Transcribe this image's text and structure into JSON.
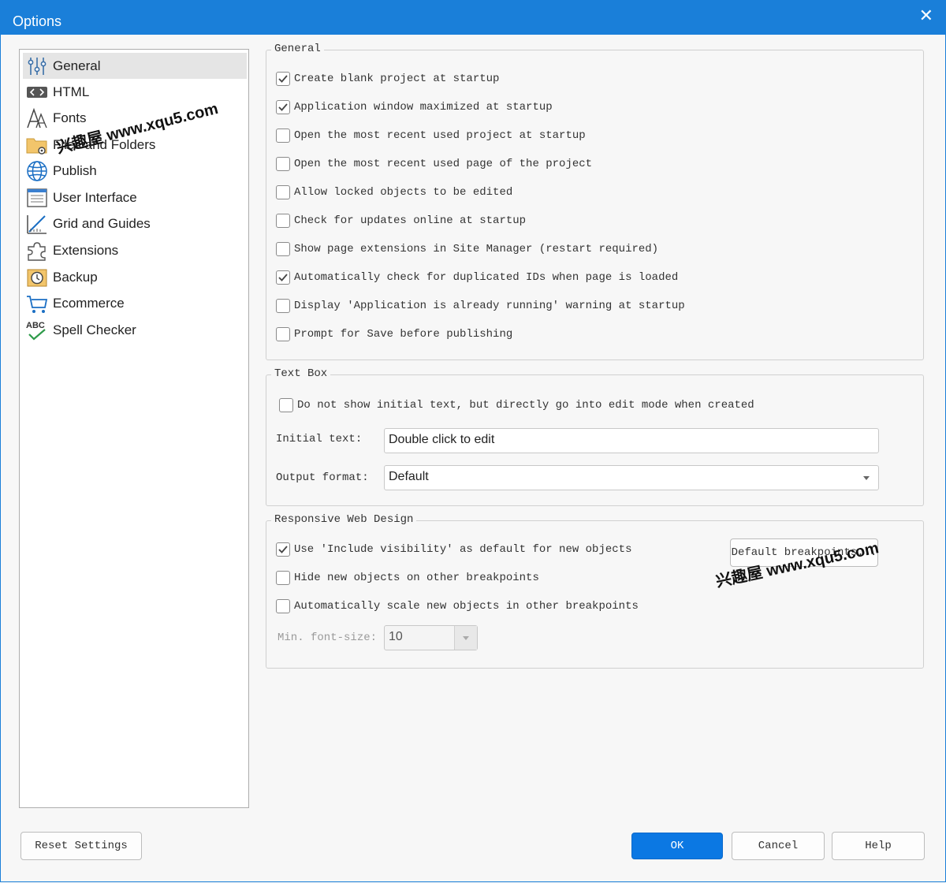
{
  "window": {
    "title": "Options",
    "close_glyph": "✕"
  },
  "sidebar": {
    "items": [
      {
        "label": "General",
        "icon": "sliders-icon",
        "active": true
      },
      {
        "label": "HTML",
        "icon": "html-tag-icon"
      },
      {
        "label": "Fonts",
        "icon": "font-icon"
      },
      {
        "label": "Files and Folders",
        "icon": "folder-gear-icon"
      },
      {
        "label": "Publish",
        "icon": "globe-icon"
      },
      {
        "label": "User Interface",
        "icon": "window-layout-icon"
      },
      {
        "label": "Grid and Guides",
        "icon": "grid-ruler-icon"
      },
      {
        "label": "Extensions",
        "icon": "puzzle-icon"
      },
      {
        "label": "Backup",
        "icon": "backup-clock-icon"
      },
      {
        "label": "Ecommerce",
        "icon": "shopping-cart-icon"
      },
      {
        "label": "Spell Checker",
        "icon": "abc-check-icon",
        "icon_text": "ABC"
      }
    ]
  },
  "general": {
    "legend": "General",
    "options": [
      {
        "label": "Create blank project at startup",
        "checked": true
      },
      {
        "label": "Application window maximized at startup",
        "checked": true
      },
      {
        "label": "Open the most recent used project at startup",
        "checked": false
      },
      {
        "label": "Open the most recent used page of the project",
        "checked": false
      },
      {
        "label": "Allow locked objects to be edited",
        "checked": false
      },
      {
        "label": "Check for updates online at startup",
        "checked": false
      },
      {
        "label": "Show page extensions in Site Manager (restart required)",
        "checked": false
      },
      {
        "label": "Automatically check for duplicated IDs when page is loaded",
        "checked": true
      },
      {
        "label": "Display 'Application is already running' warning at startup",
        "checked": false
      },
      {
        "label": "Prompt for Save before publishing",
        "checked": false
      }
    ]
  },
  "textbox": {
    "legend": "Text Box",
    "direct_edit": {
      "label": "Do not show initial text, but directly go into edit mode when created",
      "checked": false
    },
    "initial_text_label": "Initial text:",
    "initial_text_value": "Double click to edit",
    "output_format_label": "Output format:",
    "output_format_value": "Default"
  },
  "rwd": {
    "legend": "Responsive Web Design",
    "options": [
      {
        "label": "Use 'Include visibility' as default for new objects",
        "checked": true
      },
      {
        "label": "Hide new objects on other breakpoints",
        "checked": false
      },
      {
        "label": "Automatically scale new objects in other breakpoints",
        "checked": false
      }
    ],
    "breakpoints_button": "Default breakpoints...",
    "min_font_label": "Min. font-size:",
    "min_font_value": "10"
  },
  "footer": {
    "reset": "Reset Settings",
    "ok": "OK",
    "cancel": "Cancel",
    "help": "Help"
  },
  "watermarks": [
    "兴趣屋 www.xqu5.com",
    "兴趣屋 www.xqu5.com"
  ],
  "colors": {
    "titlebar": "#1a7fd9",
    "accent": "#0b78e3",
    "check": "#444444"
  }
}
